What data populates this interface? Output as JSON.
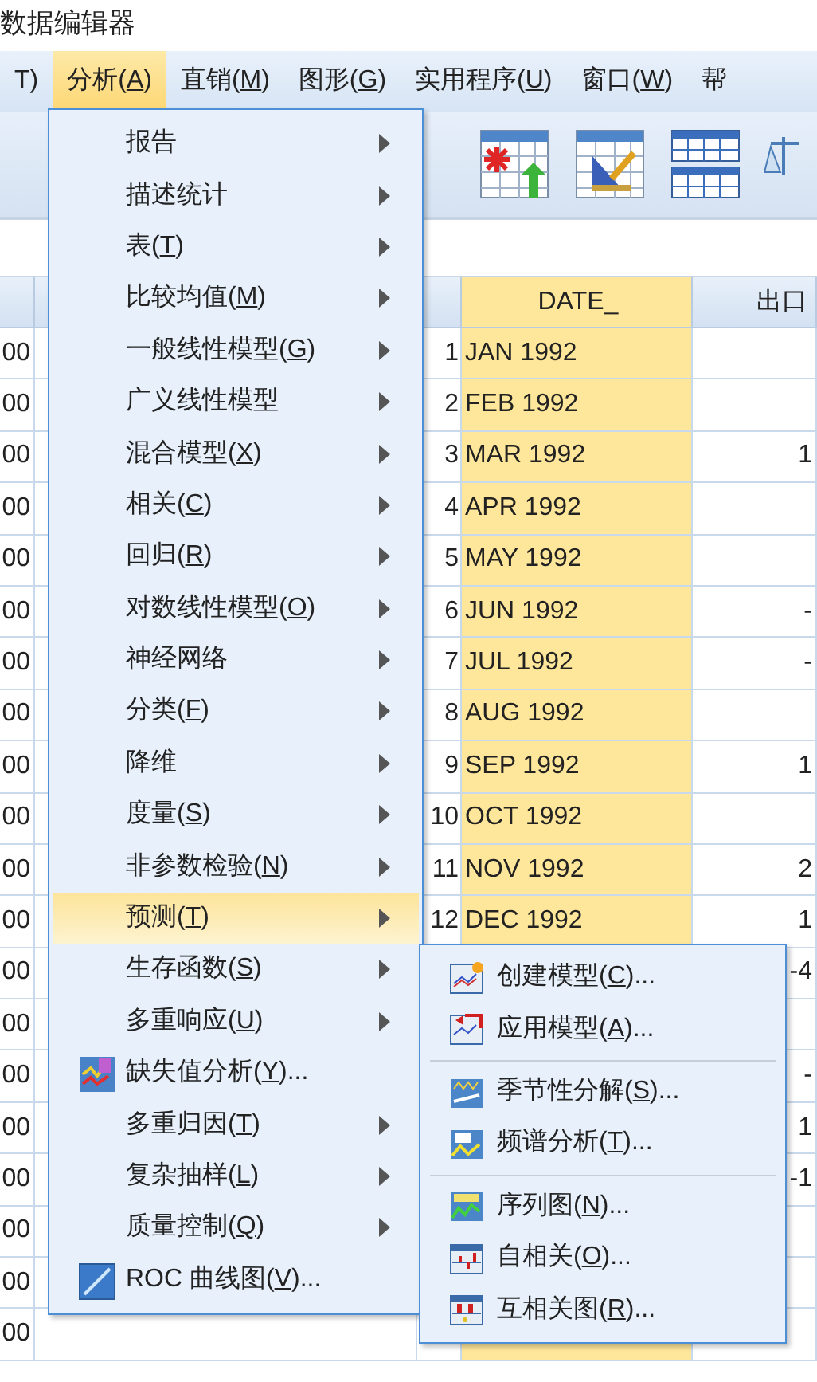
{
  "window": {
    "title": "数据编辑器"
  },
  "menubar": [
    {
      "label": "T)",
      "selected": false
    },
    {
      "label": "分析(A)",
      "selected": true
    },
    {
      "label": "直销(M)",
      "selected": false
    },
    {
      "label": "图形(G)",
      "selected": false
    },
    {
      "label": "实用程序(U)",
      "selected": false
    },
    {
      "label": "窗口(W)",
      "selected": false
    },
    {
      "label": "帮",
      "selected": false
    }
  ],
  "grid": {
    "columns": [
      "DATE_",
      "出口"
    ],
    "rows": [
      {
        "cell_1": "00",
        "number": "1",
        "date": "JAN 1992"
      },
      {
        "cell_1": "00",
        "number": "2",
        "date": "FEB 1992"
      },
      {
        "cell_1": "00",
        "number": "3",
        "date": "MAR 1992",
        "export": "1"
      },
      {
        "cell_1": "00",
        "number": "4",
        "date": "APR 1992"
      },
      {
        "cell_1": "00",
        "number": "5",
        "date": "MAY 1992"
      },
      {
        "cell_1": "00",
        "number": "6",
        "date": "JUN 1992",
        "export": "-"
      },
      {
        "cell_1": "00",
        "number": "7",
        "date": "JUL 1992",
        "export": "-"
      },
      {
        "cell_1": "00",
        "number": "8",
        "date": "AUG 1992"
      },
      {
        "cell_1": "00",
        "number": "9",
        "date": "SEP 1992",
        "export": "1"
      },
      {
        "cell_1": "00",
        "number": "10",
        "date": "OCT 1992"
      },
      {
        "cell_1": "00",
        "number": "11",
        "date": "NOV 1992",
        "export": "2"
      },
      {
        "cell_1": "00",
        "number": "12",
        "date": "DEC 1992",
        "export": "1"
      },
      {
        "cell_1": "00",
        "export": "-4"
      },
      {
        "cell_1": "00"
      },
      {
        "cell_1": "00",
        "export": "-"
      },
      {
        "cell_1": "00",
        "export": "1"
      },
      {
        "cell_1": "00",
        "export": "-1"
      },
      {
        "cell_1": "00"
      },
      {
        "cell_1": "00"
      },
      {
        "cell_1": "00"
      }
    ]
  },
  "analyze_menu": [
    {
      "label": "报告",
      "kind": "submenu",
      "selected": false
    },
    {
      "label": "描述统计",
      "kind": "submenu",
      "selected": false
    },
    {
      "label": "表(T)",
      "kind": "submenu",
      "selected": false
    },
    {
      "label": "比较均值(M)",
      "kind": "submenu",
      "selected": false
    },
    {
      "label": "一般线性模型(G)",
      "kind": "submenu",
      "selected": false
    },
    {
      "label": "广义线性模型",
      "kind": "submenu",
      "selected": false
    },
    {
      "label": "混合模型(X)",
      "kind": "submenu",
      "selected": false
    },
    {
      "label": "相关(C)",
      "kind": "submenu",
      "selected": false
    },
    {
      "label": "回归(R)",
      "kind": "submenu",
      "selected": false
    },
    {
      "label": "对数线性模型(O)",
      "kind": "submenu",
      "selected": false
    },
    {
      "label": "神经网络",
      "kind": "submenu",
      "selected": false
    },
    {
      "label": "分类(F)",
      "kind": "submenu",
      "selected": false
    },
    {
      "label": "降维",
      "kind": "submenu",
      "selected": false
    },
    {
      "label": "度量(S)",
      "kind": "submenu",
      "selected": false
    },
    {
      "label": "非参数检验(N)",
      "kind": "submenu",
      "selected": false
    },
    {
      "label": "预测(T)",
      "kind": "submenu",
      "selected": true
    },
    {
      "label": "生存函数(S)",
      "kind": "submenu",
      "selected": false
    },
    {
      "label": "多重响应(U)",
      "kind": "submenu",
      "selected": false
    },
    {
      "label": "缺失值分析(Y)...",
      "kind": "dialog",
      "selected": false
    },
    {
      "label": "多重归因(T)",
      "kind": "submenu",
      "selected": false
    },
    {
      "label": "复杂抽样(L)",
      "kind": "submenu",
      "selected": false
    },
    {
      "label": "质量控制(Q)",
      "kind": "submenu",
      "selected": false
    },
    {
      "label": "ROC 曲线图(V)...",
      "kind": "dialog",
      "selected": false
    }
  ],
  "forecast_menu": [
    {
      "label": "创建模型(C)...",
      "kind": "item"
    },
    {
      "label": "应用模型(A)...",
      "kind": "item"
    },
    {
      "kind": "separator"
    },
    {
      "label": "季节性分解(S)...",
      "kind": "item"
    },
    {
      "label": "频谱分析(T)...",
      "kind": "item"
    },
    {
      "kind": "separator"
    },
    {
      "label": "序列图(N)...",
      "kind": "item"
    },
    {
      "label": "自相关(O)...",
      "kind": "item"
    },
    {
      "label": "互相关图(R)...",
      "kind": "item"
    }
  ]
}
